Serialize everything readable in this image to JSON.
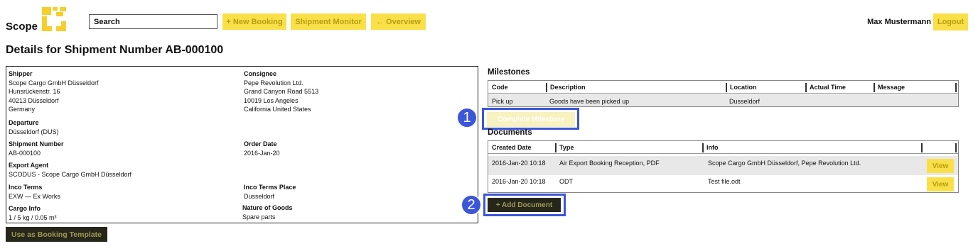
{
  "header": {
    "logo_text": "Scope",
    "search_placeholder": "Search",
    "new_booking_label": "+ New Booking",
    "shipment_monitor_label": "Shipment Monitor",
    "overview_label": "← Overview",
    "user_name": "Max Mustermann",
    "logout_label": "Logout"
  },
  "page_title": "Details for Shipment Number AB-000100",
  "details": {
    "shipper": {
      "label": "Shipper",
      "lines": [
        "Scope Cargo GmbH Düsseldorf",
        "Hunsrückenstr. 16",
        "40213 Düsseldorf",
        "Germany"
      ]
    },
    "consignee": {
      "label": "Consignee",
      "lines": [
        "Pepe Revolution Ltd.",
        "Grand Canyon Road 5513",
        "10019 Los Angeles",
        "California United States"
      ]
    },
    "departure": {
      "label": "Departure",
      "value": "Düsseldorf (DUS)"
    },
    "shipment_number": {
      "label": "Shipment Number",
      "value": "AB-000100"
    },
    "order_date": {
      "label": "Order Date",
      "value": "2016-Jan-20"
    },
    "export_agent": {
      "label": "Export Agent",
      "value": "SCODUS - Scope Cargo GmbH Düsseldorf"
    },
    "inco_terms": {
      "label": "Inco Terms",
      "value": "EXW — Ex Works"
    },
    "inco_terms_place": {
      "label": "Inco Terms Place",
      "value": "Dusseldorf"
    },
    "cargo_info": {
      "label": "Cargo Info",
      "value": "1 / 5 kg / 0.05 m³"
    },
    "nature_of_goods": {
      "label": "Nature of Goods",
      "value": "Spare parts"
    }
  },
  "use_template_label": "Use as Booking Template",
  "milestones": {
    "title": "Milestones",
    "columns": [
      "Code",
      "Description",
      "Location",
      "Actual Time",
      "Message"
    ],
    "rows": [
      {
        "code": "Pick up",
        "description": "Goods have been picked up",
        "location": "Dusseldorf",
        "actual_time": "",
        "message": ""
      }
    ],
    "complete_label": "Complete Milestone"
  },
  "documents": {
    "title": "Documents",
    "columns": [
      "Created Date",
      "Type",
      "Info",
      ""
    ],
    "rows": [
      {
        "created": "2016-Jan-20 10:18",
        "type": "Air Export Booking Reception, PDF",
        "info": "Scope Cargo GmbH Düsseldorf, Pepe Revolution Ltd.",
        "action": "View"
      },
      {
        "created": "2016-Jan-20 10:18",
        "type": "ODT",
        "info": "Test file.odt",
        "action": "View"
      }
    ],
    "add_label": "+ Add Document"
  },
  "annotations": [
    "1",
    "2"
  ],
  "colors": {
    "accent_yellow": "#f9e049",
    "dark_button": "#26261a",
    "highlight_blue": "#3b55d6"
  }
}
